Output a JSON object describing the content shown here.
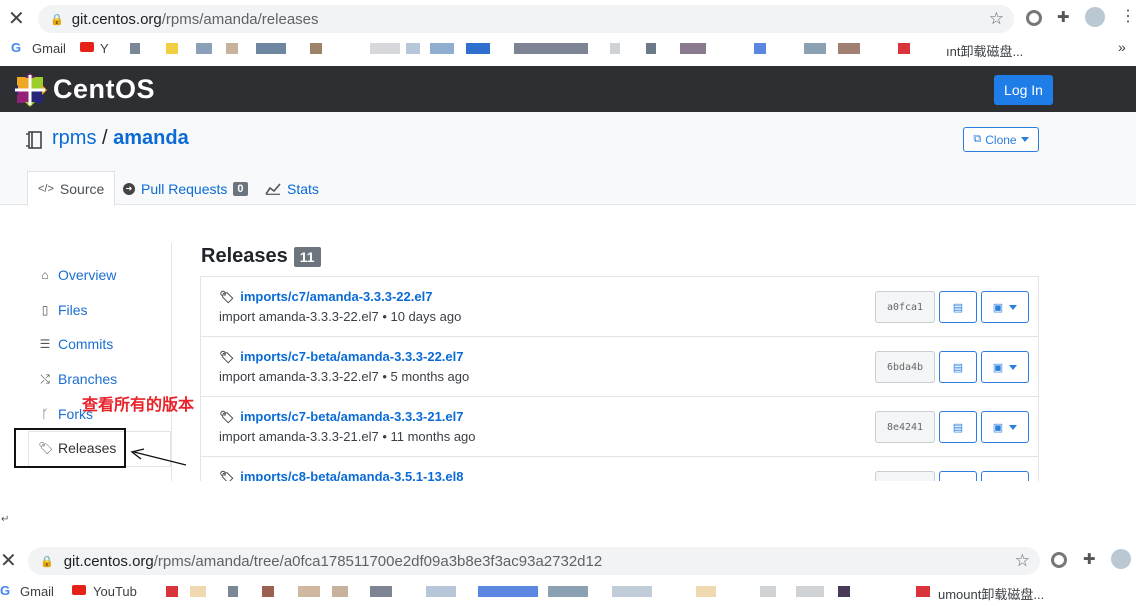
{
  "browser_top": {
    "url_host": "git.centos.org",
    "url_path": "/rpms/amanda/releases",
    "bookmarks_gmail": "Gmail",
    "bookmarks_youtube": "Y",
    "bookmarks_end": "ınt卸载磁盘...",
    "more": "»"
  },
  "navbar": {
    "brand": "CentOS",
    "login_label": "Log In"
  },
  "repo": {
    "namespace": "rpms",
    "separator": "/",
    "name": "amanda",
    "clone_label": "Clone"
  },
  "tabs": {
    "source": "Source",
    "pull_requests": "Pull Requests",
    "pull_requests_count": "0",
    "stats": "Stats"
  },
  "sidebar": {
    "items": [
      {
        "label": "Overview",
        "icon": "home-icon"
      },
      {
        "label": "Files",
        "icon": "file-icon"
      },
      {
        "label": "Commits",
        "icon": "list-icon"
      },
      {
        "label": "Branches",
        "icon": "shuffle-icon"
      },
      {
        "label": "Forks",
        "icon": "fork-icon"
      },
      {
        "label": "Releases",
        "icon": "tags-icon"
      }
    ]
  },
  "releases": {
    "title": "Releases",
    "count": "11",
    "items": [
      {
        "tag": "imports/c7/amanda-3.3.3-22.el7",
        "meta": "import amanda-3.3.3-22.el7 • 10 days ago",
        "hash": "a0fca1"
      },
      {
        "tag": "imports/c7-beta/amanda-3.3.3-22.el7",
        "meta": "import amanda-3.3.3-22.el7 • 5 months ago",
        "hash": "6bda4b"
      },
      {
        "tag": "imports/c7-beta/amanda-3.3.3-21.el7",
        "meta": "import amanda-3.3.3-21.el7 • 11 months ago",
        "hash": "8e4241"
      },
      {
        "tag": "imports/c8-beta/amanda-3.5.1-13.el8",
        "meta": "",
        "hash": ""
      }
    ]
  },
  "annotation": {
    "text": "查看所有的版本"
  },
  "paragraph_mark": "↵",
  "browser_bottom": {
    "url_host": "git.centos.org",
    "url_path": "/rpms/amanda/tree/a0fca178511700e2df09a3b8e3f3ac93a2732d12",
    "bookmarks_gmail": "Gmail",
    "bookmarks_youtube": "YouTub",
    "bookmarks_end": "umount卸载磁盘..."
  },
  "colors": {
    "link": "#0a6bd6",
    "navbar": "#2d2f33",
    "login": "#1e7de6",
    "annotation_red": "#e8232a"
  }
}
